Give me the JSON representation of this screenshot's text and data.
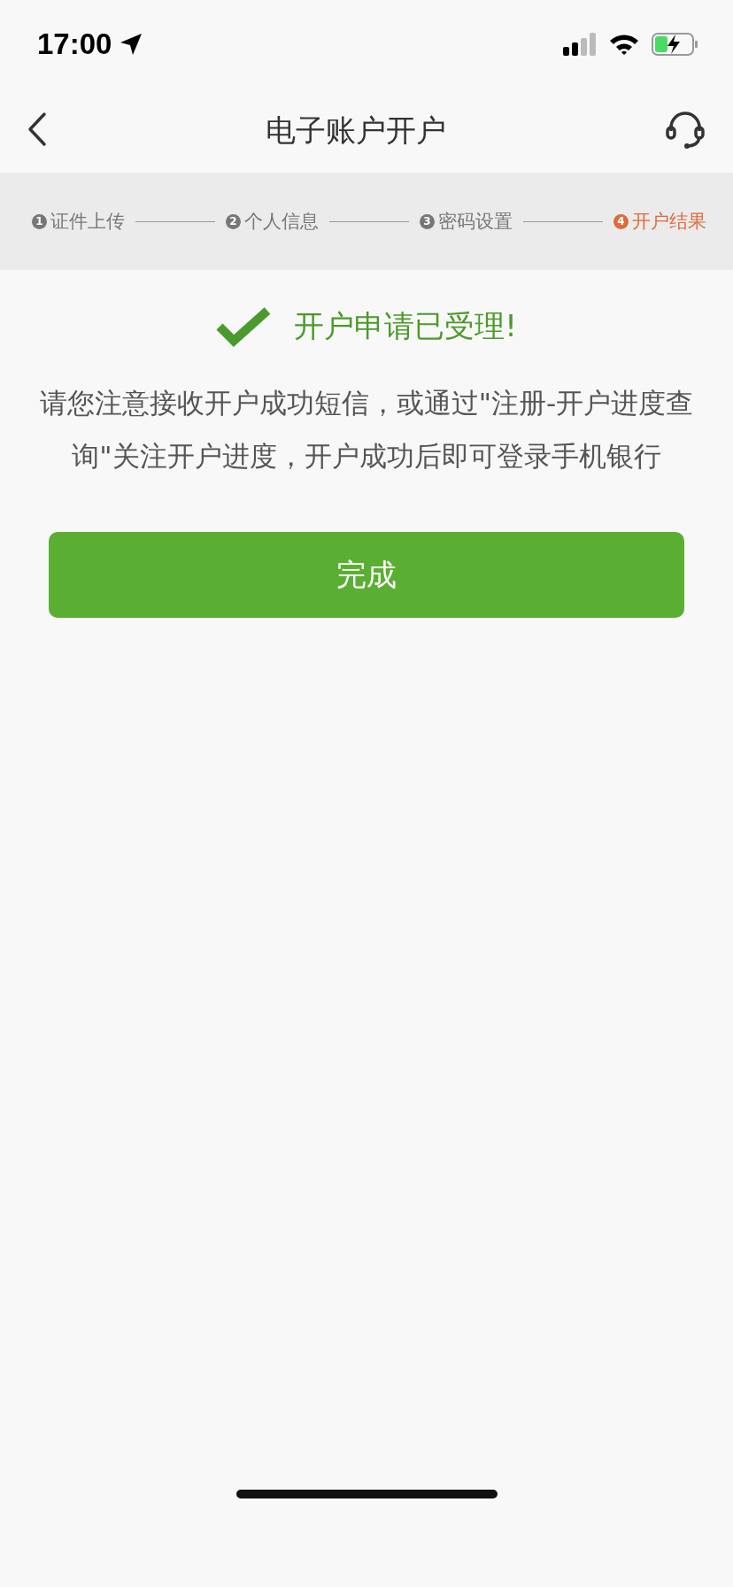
{
  "status_bar": {
    "time": "17:00"
  },
  "nav_bar": {
    "title": "电子账户开户"
  },
  "steps": [
    {
      "number": "1",
      "label": "证件上传",
      "selected": false
    },
    {
      "number": "2",
      "label": "个人信息",
      "selected": false
    },
    {
      "number": "3",
      "label": "密码设置",
      "selected": false
    },
    {
      "number": "4",
      "label": "开户结果",
      "selected": true
    }
  ],
  "result": {
    "title": "开户申请已受理!",
    "message": "请您注意接收开户成功短信，或通过\"注册-开户进度查询\"关注开户进度，开户成功后即可登录手机银行"
  },
  "buttons": [
    "完成"
  ]
}
